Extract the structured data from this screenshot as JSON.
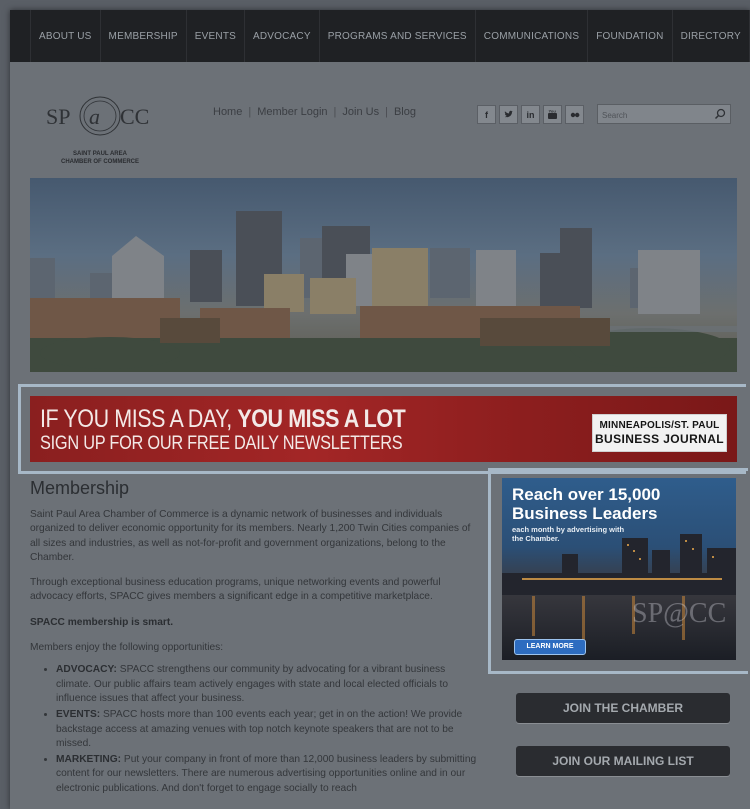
{
  "nav": {
    "items": [
      "ABOUT US",
      "MEMBERSHIP",
      "EVENTS",
      "ADVOCACY",
      "PROGRAMS AND SERVICES",
      "COMMUNICATIONS",
      "FOUNDATION",
      "DIRECTORY"
    ]
  },
  "header": {
    "logo_mark": "SP@CC",
    "logo_sub_1": "SAINT PAUL AREA",
    "logo_sub_2": "CHAMBER OF COMMERCE",
    "links": [
      "Home",
      "Member Login",
      "Join Us",
      "Blog"
    ],
    "social_icons": [
      "facebook-icon",
      "twitter-icon",
      "linkedin-icon",
      "youtube-icon",
      "flickr-icon"
    ],
    "search_placeholder": "Search"
  },
  "banner": {
    "line1_light": "IF YOU MISS A DAY, ",
    "line1_bold": "YOU MISS A LOT",
    "line2": "SIGN UP FOR OUR FREE DAILY NEWSLETTERS",
    "logo_line1": "MINNEAPOLIS/ST. PAUL",
    "logo_line2": "BUSINESS JOURNAL"
  },
  "main": {
    "title": "Membership",
    "para1": "Saint Paul Area Chamber of Commerce is a dynamic network of businesses and individuals organized to deliver economic opportunity for its members. Nearly 1,200 Twin Cities companies of all sizes and industries, as well as not-for-profit and government organizations, belong to the Chamber.",
    "para2": "Through exceptional business education programs, unique networking events and powerful advocacy efforts, SPACC gives members a significant edge in a competitive marketplace.",
    "para3": "SPACC membership is smart.",
    "para4": "Members enjoy the following opportunities:",
    "bullets": [
      {
        "term": "ADVOCACY:",
        "text": " SPACC strengthens our community by advocating for a vibrant business climate. Our public affairs team actively engages with state and local elected officials to influence issues that affect your business."
      },
      {
        "term": "EVENTS:",
        "text": " SPACC hosts more than 100 events each year; get in on the action! We provide backstage access at amazing venues with top notch keynote speakers that are not to be missed."
      },
      {
        "term": "MARKETING:",
        "text": " Put your company in front of more than 12,000 business leaders by submitting content for our newsletters. There are numerous advertising opportunities online and in our electronic publications. And don't forget to engage socially to reach"
      }
    ]
  },
  "ad": {
    "line1": "Reach over 15,000",
    "line2": "Business Leaders",
    "line3": "each month by advertising with the Chamber.",
    "button": "LEARN MORE",
    "watermark": "SP@CC"
  },
  "sidebar": {
    "join_chamber": "JOIN THE CHAMBER",
    "join_mailing": "JOIN OUR MAILING LIST"
  },
  "colors": {
    "nav_bg": "#1f2124",
    "banner_red": "#a32626",
    "overlay": "#6c7177"
  }
}
